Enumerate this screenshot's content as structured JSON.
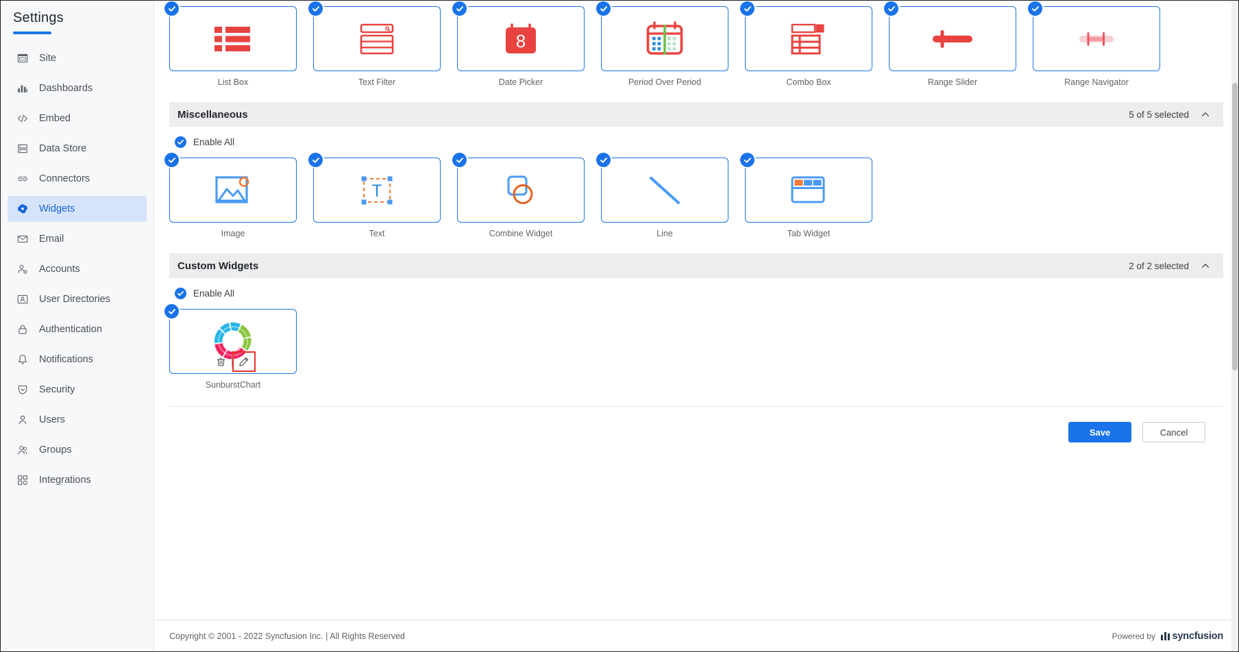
{
  "sidebar": {
    "title": "Settings",
    "items": [
      {
        "label": "Site",
        "icon": "site-icon",
        "active": false
      },
      {
        "label": "Dashboards",
        "icon": "dashboards-icon",
        "active": false
      },
      {
        "label": "Embed",
        "icon": "embed-code-icon",
        "active": false
      },
      {
        "label": "Data Store",
        "icon": "data-store-icon",
        "active": false
      },
      {
        "label": "Connectors",
        "icon": "link-icon",
        "active": false
      },
      {
        "label": "Widgets",
        "icon": "widgets-icon",
        "active": true
      },
      {
        "label": "Email",
        "icon": "envelope-icon",
        "active": false
      },
      {
        "label": "Accounts",
        "icon": "account-gear-icon",
        "active": false
      },
      {
        "label": "User Directories",
        "icon": "user-card-icon",
        "active": false
      },
      {
        "label": "Authentication",
        "icon": "lock-icon",
        "active": false
      },
      {
        "label": "Notifications",
        "icon": "bell-icon",
        "active": false
      },
      {
        "label": "Security",
        "icon": "shield-icon",
        "active": false
      },
      {
        "label": "Users",
        "icon": "user-icon",
        "active": false
      },
      {
        "label": "Groups",
        "icon": "users-group-icon",
        "active": false
      },
      {
        "label": "Integrations",
        "icon": "integrations-icon",
        "active": false
      }
    ]
  },
  "filters_section": {
    "cards": [
      {
        "label": "List Box",
        "icon": "list-box-icon",
        "checked": true
      },
      {
        "label": "Text Filter",
        "icon": "text-filter-icon",
        "checked": true
      },
      {
        "label": "Date Picker",
        "icon": "date-picker-icon",
        "checked": true,
        "day": "8"
      },
      {
        "label": "Period Over Period",
        "icon": "period-over-period-icon",
        "checked": true
      },
      {
        "label": "Combo Box",
        "icon": "combo-box-icon",
        "checked": true
      },
      {
        "label": "Range Slider",
        "icon": "range-slider-icon",
        "checked": true
      },
      {
        "label": "Range Navigator",
        "icon": "range-navigator-icon",
        "checked": true
      }
    ]
  },
  "miscellaneous_section": {
    "title": "Miscellaneous",
    "count": "5 of 5 selected",
    "chevron": "chevron-up-icon",
    "enable_all": "Enable All",
    "cards": [
      {
        "label": "Image",
        "icon": "image-icon",
        "checked": true
      },
      {
        "label": "Text",
        "icon": "text-icon",
        "checked": true
      },
      {
        "label": "Combine Widget",
        "icon": "combine-widget-icon",
        "checked": true
      },
      {
        "label": "Line",
        "icon": "line-icon",
        "checked": true
      },
      {
        "label": "Tab Widget",
        "icon": "tab-widget-icon",
        "checked": true
      }
    ]
  },
  "custom_section": {
    "title": "Custom Widgets",
    "count": "2 of 2 selected",
    "chevron": "chevron-up-icon",
    "enable_all": "Enable All",
    "cards": [
      {
        "label": "SunburstChart",
        "icon": "sunburst-chart-icon",
        "checked": true,
        "delete_icon": "trash-icon",
        "edit_icon": "pencil-icon"
      }
    ]
  },
  "actions": {
    "save_label": "Save",
    "cancel_label": "Cancel"
  },
  "footer": {
    "copyright": "Copyright © 2001 - 2022 Syncfusion Inc.  |  All Rights Reserved",
    "powered_by": "Powered by",
    "brand": "syncfusion"
  },
  "colors": {
    "accent": "#1a73e8",
    "filter_icon_red": "#e8433f",
    "highlight_red": "#e8312b",
    "section_bar": "#ededed"
  }
}
